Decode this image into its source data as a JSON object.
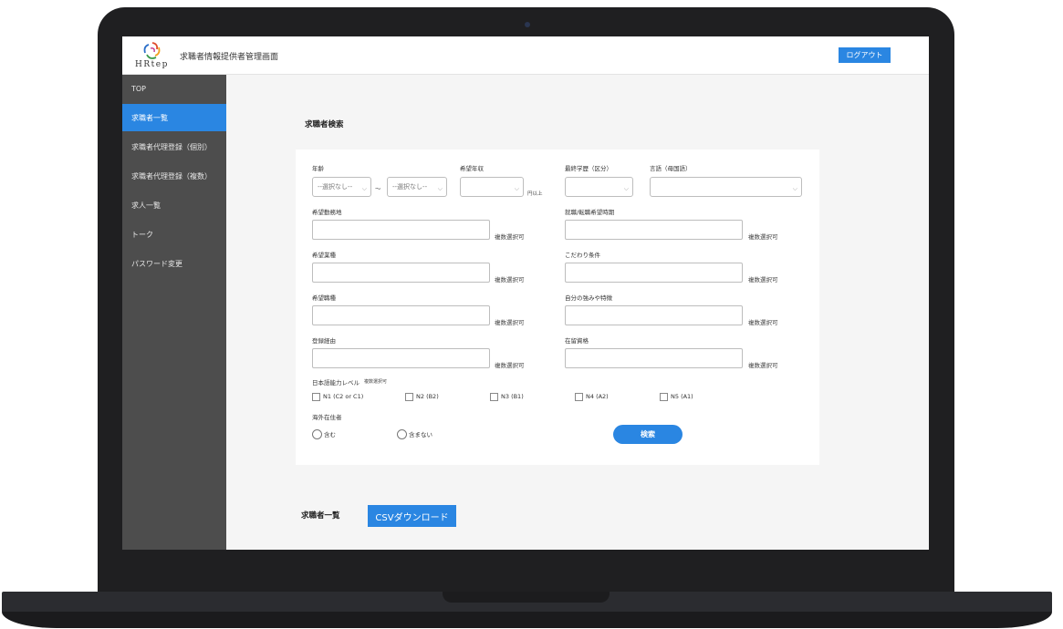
{
  "header": {
    "logo_text": "HRtep",
    "app_title": "求職者情報提供者管理画面",
    "logout_label": "ログアウト"
  },
  "sidebar": {
    "items": [
      {
        "label": "TOP"
      },
      {
        "label": "求職者一覧",
        "active": true
      },
      {
        "label": "求職者代理登録（個別）"
      },
      {
        "label": "求職者代理登録（複数）"
      },
      {
        "label": "求人一覧"
      },
      {
        "label": "トーク"
      },
      {
        "label": "パスワード変更"
      }
    ]
  },
  "search": {
    "section_title": "求職者検索",
    "age_label": "年齢",
    "age_from_value": "--選択なし--",
    "age_separator": "～",
    "age_to_value": "--選択なし--",
    "salary_label": "希望年収",
    "salary_suffix": "円以上",
    "education_label": "最終学歴（区分）",
    "language_label": "言語（母国語）",
    "work_location_label": "希望勤務地",
    "start_time_label": "就職/転職希望時期",
    "industry_label": "希望業種",
    "conditions_label": "こだわり条件",
    "occupation_label": "希望職種",
    "strengths_label": "自分の強みや特徴",
    "registration_route_label": "登録経由",
    "residence_status_label": "在留資格",
    "multi_select_hint": "複数選択可",
    "jlpt_label": "日本語能力レベル",
    "jlpt_hint": "複数選択可",
    "jlpt_options": [
      "N1 (C2 or C1)",
      "N2 (B2)",
      "N3 (B1)",
      "N4 (A2)",
      "N5 (A1)"
    ],
    "overseas_label": "海外在住者",
    "overseas_options": [
      "含む",
      "含まない"
    ],
    "search_button_label": "検索"
  },
  "list": {
    "section_title": "求職者一覧",
    "csv_button_label": "CSVダウンロード"
  },
  "colors": {
    "accent": "#2a86e2",
    "sidebar_bg": "#4d4d4d",
    "main_bg": "#f5f5f5"
  }
}
